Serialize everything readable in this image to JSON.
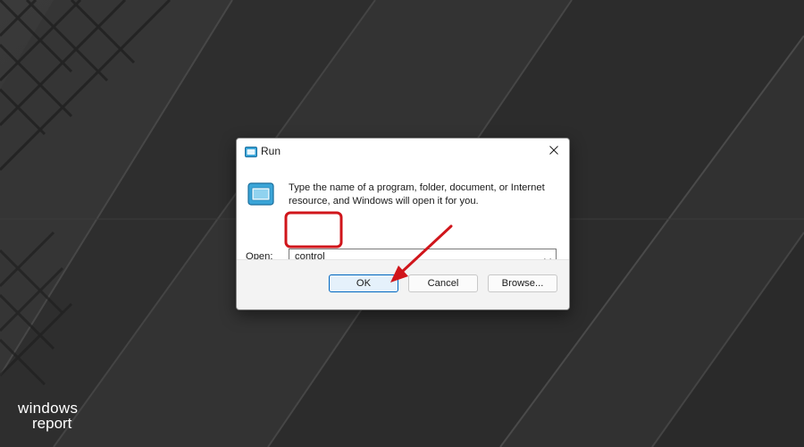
{
  "dialog": {
    "title": "Run",
    "description": "Type the name of a program, folder, document, or Internet resource, and Windows will open it for you.",
    "open_label": "Open:",
    "open_access_key": "O",
    "open_label_rest": "pen:",
    "input_value": "control",
    "buttons": {
      "ok": "OK",
      "cancel": "Cancel",
      "browse": "Browse..."
    },
    "icons": {
      "title": "run-icon",
      "content": "run-icon",
      "close": "close-icon",
      "dropdown": "chevron-down-icon"
    }
  },
  "annotations": {
    "highlight_color": "#d0151b",
    "arrow_color": "#d0151b"
  },
  "logo": {
    "line1": "windows",
    "line2": "report"
  },
  "colors": {
    "accent": "#0067c0",
    "dialog_footer": "#f3f3f3",
    "wallpaper": "#2f2f2f"
  }
}
